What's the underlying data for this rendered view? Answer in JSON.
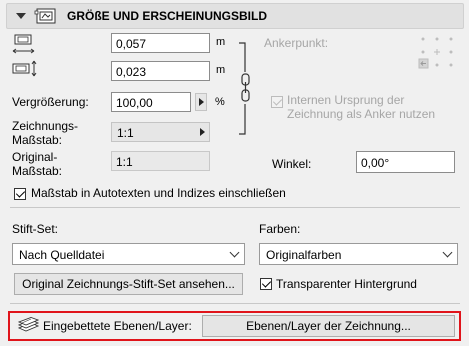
{
  "header": {
    "title": "GRÖßE UND ERSCHEINUNGSBILD",
    "icon": "drawing-frame-icon"
  },
  "size": {
    "width_value": "0,057",
    "height_value": "0,023",
    "unit": "m",
    "magnification_label": "Vergrößerung:",
    "magnification_value": "100,00",
    "magnification_unit": "%",
    "drawing_scale_label_1": "Zeichnungs-",
    "drawing_scale_label_2": "Maßstab:",
    "drawing_scale_value": "1:1",
    "original_scale_label_1": "Original-",
    "original_scale_label_2": "Maßstab:",
    "original_scale_value": "1:1"
  },
  "anchor": {
    "label": "Ankerpunkt:",
    "use_origin_label_1": "Internen Ursprung der",
    "use_origin_label_2": "Zeichnung als Anker nutzen",
    "angle_label": "Winkel:",
    "angle_value": "0,00°"
  },
  "scale_in_autotext_label": "Maßstab in Autotexten und Indizes einschließen",
  "pen_set": {
    "label": "Stift-Set:",
    "selected": "Nach Quelldatei",
    "view_button": "Original Zeichnungs-Stift-Set ansehen..."
  },
  "colors": {
    "label": "Farben:",
    "selected": "Originalfarben",
    "transparent_label": "Transparenter Hintergrund"
  },
  "layers": {
    "label": "Eingebettete Ebenen/Layer:",
    "button": "Ebenen/Layer der Zeichnung...",
    "highlight_color": "#e0141b"
  }
}
